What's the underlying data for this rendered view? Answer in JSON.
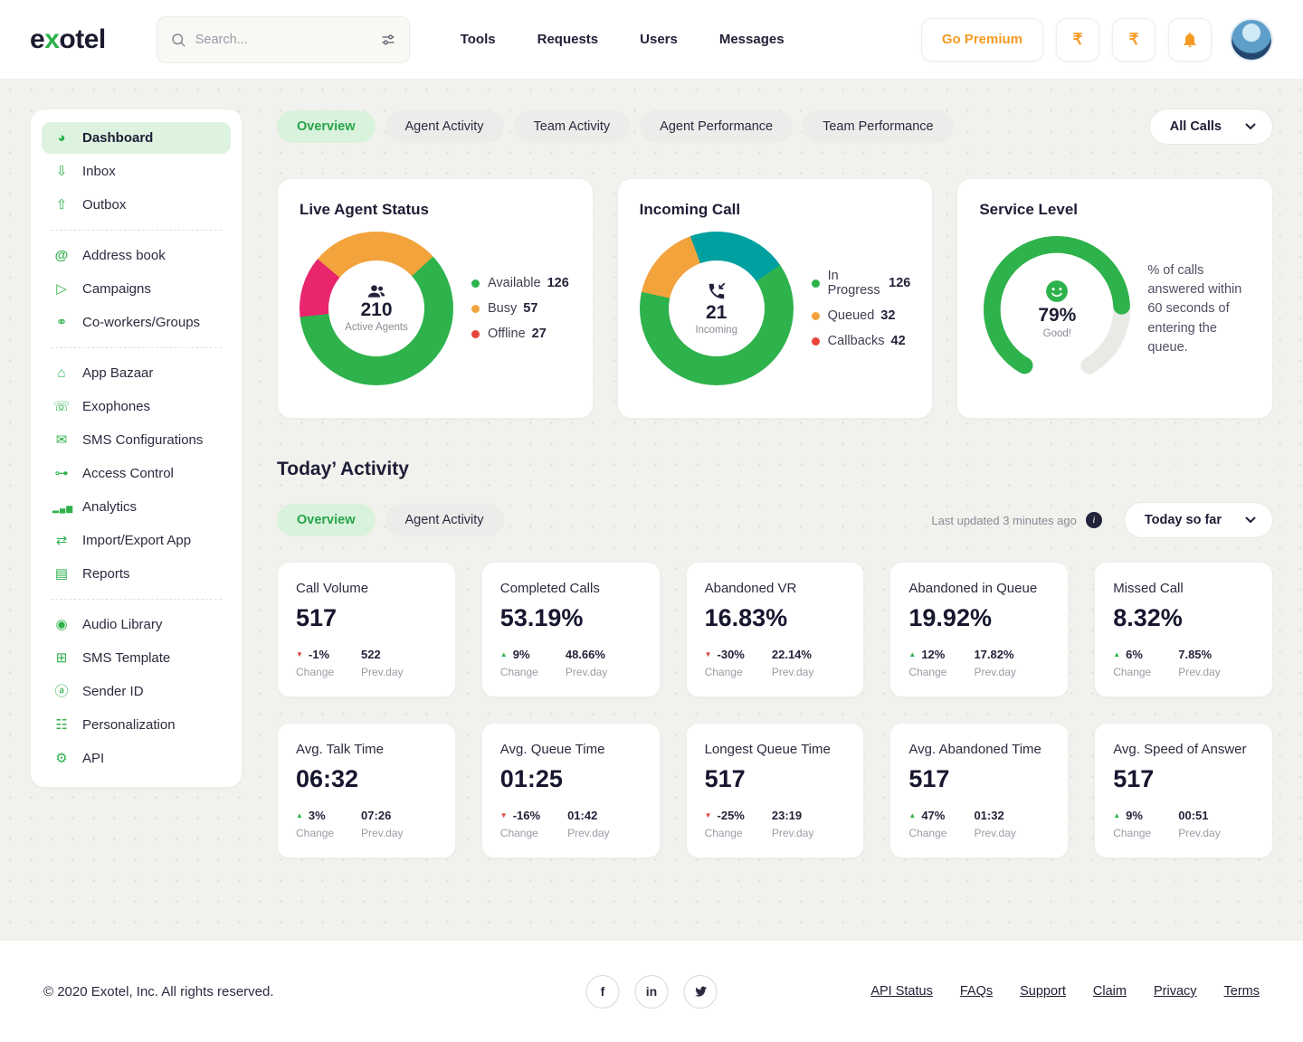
{
  "brand": {
    "logo_pre": "e",
    "logo_accent": "x",
    "logo_post": "otel"
  },
  "nav": {
    "search_placeholder": "Search...",
    "links": [
      {
        "label": "Tools"
      },
      {
        "label": "Requests"
      },
      {
        "label": "Users"
      },
      {
        "label": "Messages"
      }
    ],
    "premium_label": "Go Premium",
    "currency_buttons": [
      {
        "symbol": "₹"
      },
      {
        "symbol": "₹"
      }
    ]
  },
  "sidebar": {
    "groups": [
      [
        {
          "label": "Dashboard",
          "icon": "dashboard",
          "active": true
        },
        {
          "label": "Inbox",
          "icon": "inbox",
          "active": false
        },
        {
          "label": "Outbox",
          "icon": "outbox",
          "active": false
        }
      ],
      [
        {
          "label": "Address book",
          "icon": "address-book",
          "active": false
        },
        {
          "label": "Campaigns",
          "icon": "campaigns",
          "active": false
        },
        {
          "label": "Co-workers/Groups",
          "icon": "co-workers",
          "active": false
        }
      ],
      [
        {
          "label": "App Bazaar",
          "icon": "app-bazaar",
          "active": false
        },
        {
          "label": "Exophones",
          "icon": "exophones",
          "active": false
        },
        {
          "label": "SMS Configurations",
          "icon": "sms-config",
          "active": false
        },
        {
          "label": "Access Control",
          "icon": "access-control",
          "active": false
        },
        {
          "label": "Analytics",
          "icon": "analytics",
          "active": false
        },
        {
          "label": "Import/Export App",
          "icon": "import-export",
          "active": false
        },
        {
          "label": "Reports",
          "icon": "reports",
          "active": false
        }
      ],
      [
        {
          "label": "Audio Library",
          "icon": "audio-library",
          "active": false
        },
        {
          "label": "SMS Template",
          "icon": "sms-template",
          "active": false
        },
        {
          "label": "Sender ID",
          "icon": "sender-id",
          "active": false
        },
        {
          "label": "Personalization",
          "icon": "personalization",
          "active": false
        },
        {
          "label": "API",
          "icon": "api",
          "active": false
        }
      ]
    ]
  },
  "main_tabs": {
    "tabs": [
      {
        "label": "Overview",
        "active": true
      },
      {
        "label": "Agent Activity",
        "active": false
      },
      {
        "label": "Team Activity",
        "active": false
      },
      {
        "label": "Agent Performance",
        "active": false
      },
      {
        "label": "Team Performance",
        "active": false
      }
    ],
    "filter_label": "All Calls"
  },
  "cards": {
    "live_agent_status": {
      "title": "Live Agent Status",
      "center_value": "210",
      "center_caption": "Active Agents",
      "chart": {
        "type": "donut",
        "start_deg": -50,
        "segments": [
          {
            "label": "Busy",
            "pct": 27.1,
            "color": "#f2a33c"
          },
          {
            "label": "Available",
            "pct": 60,
            "color": "#2eb24c"
          },
          {
            "label": "Offline",
            "pct": 12.9,
            "color": "#e8256d"
          }
        ]
      },
      "legend": [
        {
          "label": "Available",
          "value": "126",
          "color": "#2eb24c"
        },
        {
          "label": "Busy",
          "value": "57",
          "color": "#f2a33c"
        },
        {
          "label": "Offline",
          "value": "27",
          "color": "#e8443a"
        }
      ]
    },
    "incoming_call": {
      "title": "Incoming Call",
      "center_value": "21",
      "center_caption": "Incoming",
      "chart": {
        "type": "donut",
        "start_deg": -20,
        "segments": [
          {
            "label": "Callbacks",
            "pct": 21,
            "color": "#01a0a0"
          },
          {
            "label": "In Progress",
            "pct": 63,
            "color": "#2eb24c"
          },
          {
            "label": "Queued",
            "pct": 16,
            "color": "#f2a33c"
          }
        ]
      },
      "legend": [
        {
          "label": "In Progress",
          "value": "126",
          "color": "#2eb24c"
        },
        {
          "label": "Queued",
          "value": "32",
          "color": "#f2a33c"
        },
        {
          "label": "Callbacks",
          "value": "42",
          "color": "#e8443a"
        }
      ]
    },
    "service_level": {
      "title": "Service Level",
      "gauge": {
        "percent": 79,
        "label": "79%",
        "caption": "Good!",
        "color": "#2eb24c",
        "track_color": "#e9e9e5"
      },
      "description": "% of calls answered within 60 seconds of entering the queue."
    }
  },
  "today_activity": {
    "title": "Today’ Activity",
    "tabs": [
      {
        "label": "Overview",
        "active": true
      },
      {
        "label": "Agent Activity",
        "active": false
      }
    ],
    "last_updated": "Last updated 3 minutes ago",
    "range_label": "Today so far",
    "change_caption": "Change",
    "prev_caption": "Prev.day",
    "stats": [
      {
        "label": "Call Volume",
        "value": "517",
        "change": "-1%",
        "dir": "down",
        "prev": "522"
      },
      {
        "label": "Completed Calls",
        "value": "53.19%",
        "change": "9%",
        "dir": "up",
        "prev": "48.66%"
      },
      {
        "label": "Abandoned VR",
        "value": "16.83%",
        "change": "-30%",
        "dir": "down",
        "prev": "22.14%"
      },
      {
        "label": "Abandoned in Queue",
        "value": "19.92%",
        "change": "12%",
        "dir": "up",
        "prev": "17.82%"
      },
      {
        "label": "Missed Call",
        "value": "8.32%",
        "change": "6%",
        "dir": "up",
        "prev": "7.85%"
      },
      {
        "label": "Avg. Talk Time",
        "value": "06:32",
        "change": "3%",
        "dir": "up",
        "prev": "07:26"
      },
      {
        "label": "Avg. Queue Time",
        "value": "01:25",
        "change": "-16%",
        "dir": "down",
        "prev": "01:42"
      },
      {
        "label": "Longest Queue Time",
        "value": "517",
        "change": "-25%",
        "dir": "down",
        "prev": "23:19"
      },
      {
        "label": "Avg. Abandoned Time",
        "value": "517",
        "change": "47%",
        "dir": "up",
        "prev": "01:32"
      },
      {
        "label": "Avg. Speed of Answer",
        "value": "517",
        "change": "9%",
        "dir": "up",
        "prev": "00:51"
      }
    ]
  },
  "footer": {
    "copyright": "© 2020 Exotel, Inc. All rights reserved.",
    "social": [
      {
        "label": "f"
      },
      {
        "label": "in"
      }
    ],
    "links": [
      {
        "label": "API Status"
      },
      {
        "label": "FAQs"
      },
      {
        "label": "Support"
      },
      {
        "label": "Claim"
      },
      {
        "label": "Privacy"
      },
      {
        "label": "Terms"
      }
    ]
  }
}
